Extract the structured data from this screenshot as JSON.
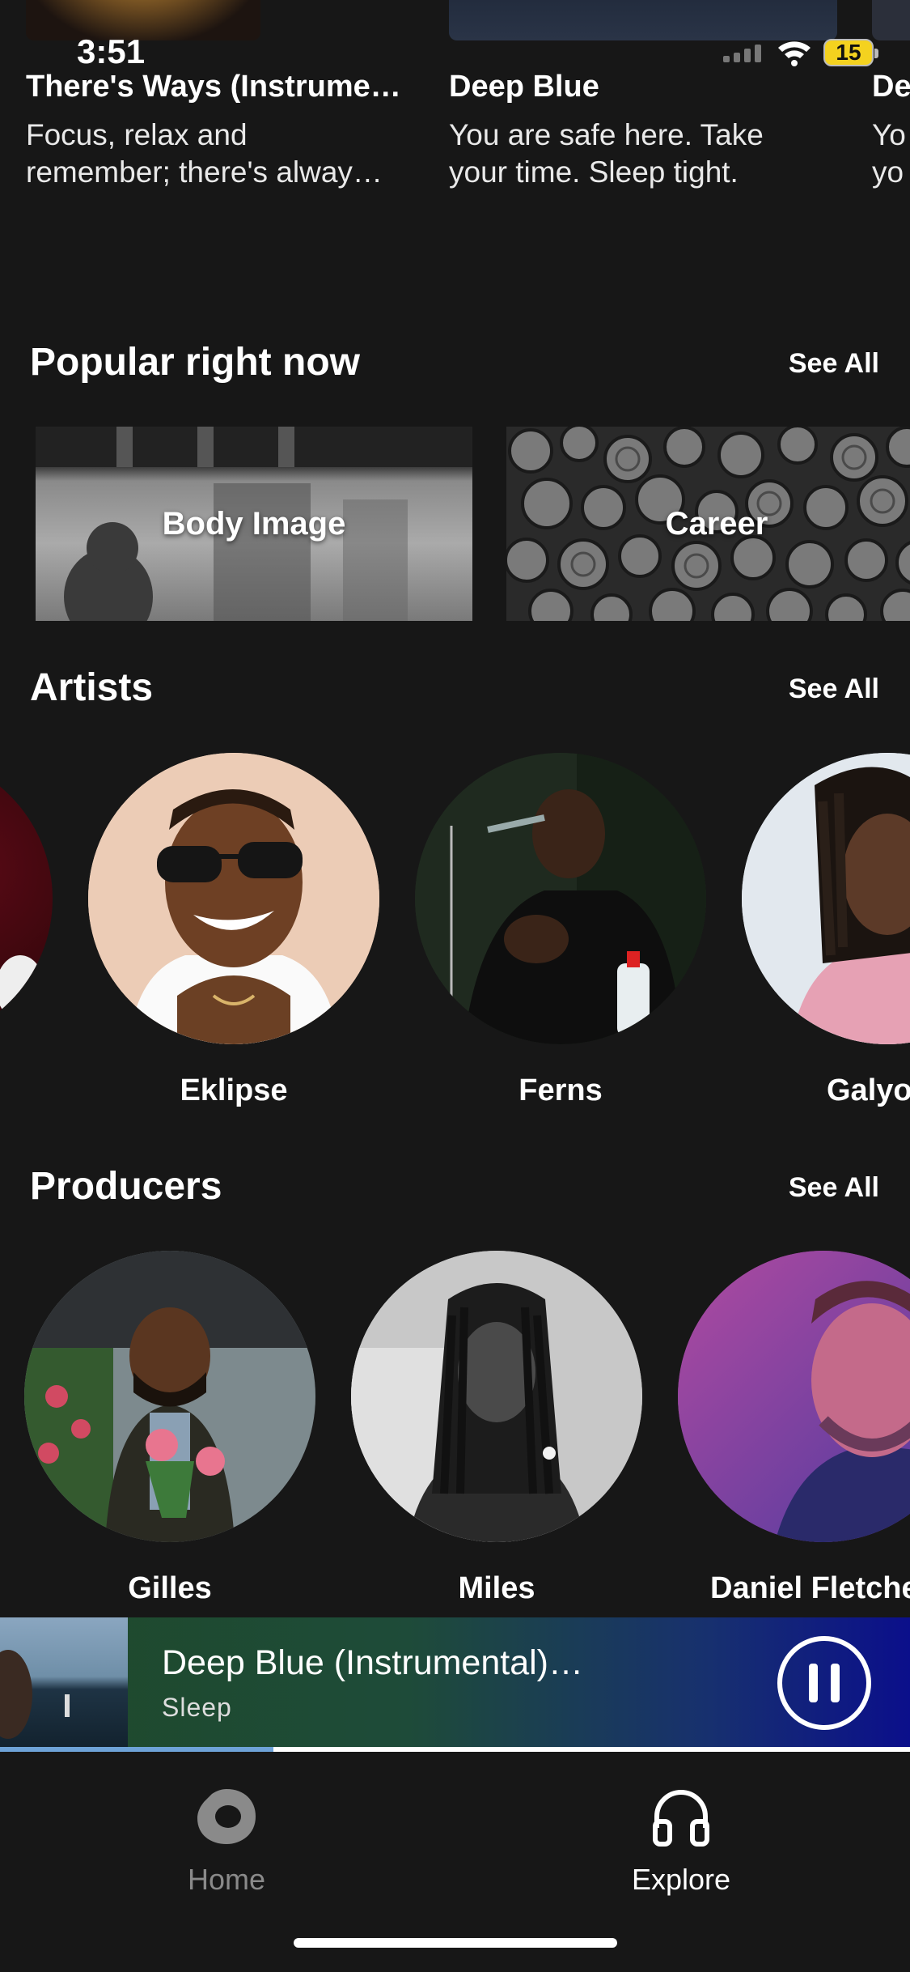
{
  "status_bar": {
    "time": "3:51",
    "battery": "15"
  },
  "top_cards": [
    {
      "title": "There's Ways (Instrume…",
      "desc_line1": "Focus,  relax and",
      "desc_line2": "remember; there's alway…"
    },
    {
      "title": "Deep Blue",
      "desc_line1": "You are safe here. Take",
      "desc_line2": "your time. Sleep tight."
    },
    {
      "title": "De",
      "desc_line1": "Yo",
      "desc_line2": "yo"
    }
  ],
  "popular": {
    "title": "Popular right now",
    "see_all": "See All",
    "tiles": [
      {
        "label": "Body Image"
      },
      {
        "label": "Career"
      }
    ]
  },
  "artists": {
    "title": "Artists",
    "see_all": "See All",
    "items": [
      {
        "name": "Eklipse"
      },
      {
        "name": "Ferns"
      },
      {
        "name": "Galyo"
      }
    ]
  },
  "producers": {
    "title": "Producers",
    "see_all": "See All",
    "items": [
      {
        "name": "Gilles"
      },
      {
        "name": "Miles"
      },
      {
        "name": "Daniel Fletche"
      }
    ]
  },
  "player": {
    "title": "Deep Blue (Instrumental)…",
    "subtitle": "Sleep",
    "progress": 0.3
  },
  "tabs": [
    {
      "label": "Home",
      "active": false
    },
    {
      "label": "Explore",
      "active": true
    }
  ],
  "colors": {
    "background": "#171717",
    "tab_inactive": "#8a8a8a",
    "tab_active": "#ffffff",
    "progress": "#6ea3d8"
  }
}
